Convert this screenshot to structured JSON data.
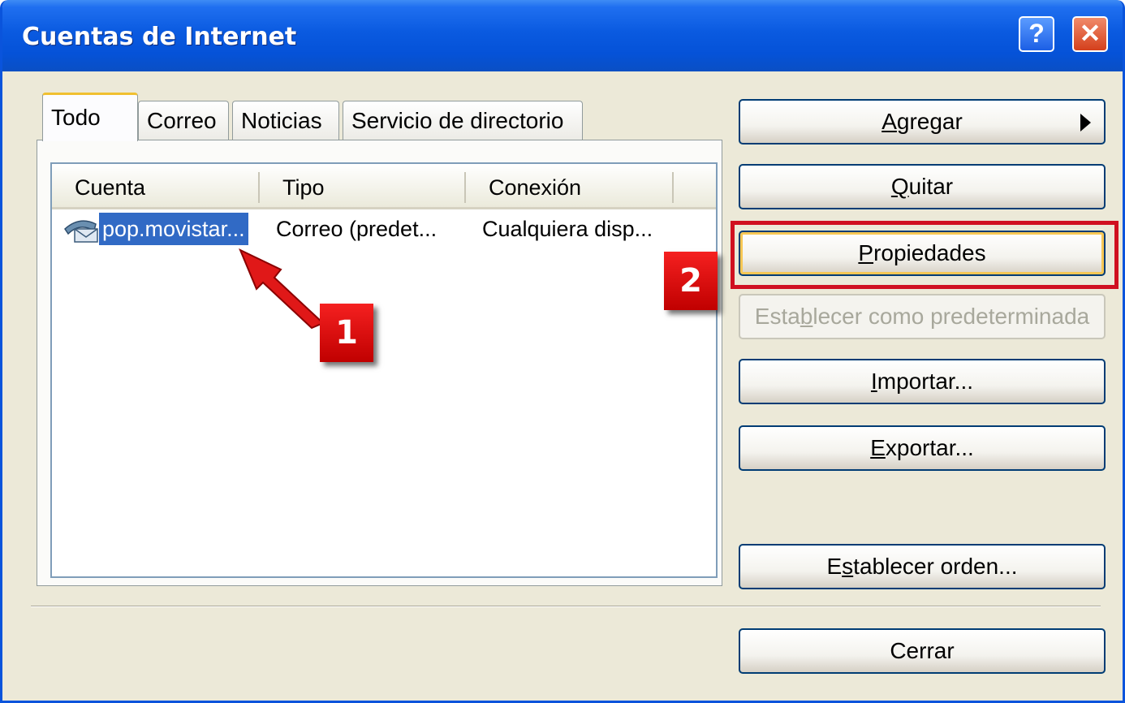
{
  "window": {
    "title": "Cuentas de Internet"
  },
  "titlebar": {
    "help_glyph": "?",
    "close_glyph": "✕"
  },
  "tabs": [
    {
      "label": "Todo",
      "active": true
    },
    {
      "label": "Correo",
      "active": false
    },
    {
      "label": "Noticias",
      "active": false
    },
    {
      "label": "Servicio de directorio",
      "active": false
    }
  ],
  "list": {
    "columns": [
      "Cuenta",
      "Tipo",
      "Conexión"
    ],
    "rows": [
      {
        "account": "pop.movistar...",
        "type": "Correo (predet...",
        "connection": "Cualquiera disp...",
        "selected": true,
        "icon": "mail-account-icon"
      }
    ]
  },
  "buttons": {
    "agregar": {
      "pre": "",
      "key": "A",
      "post": "gregar"
    },
    "quitar": {
      "pre": "",
      "key": "Q",
      "post": "uitar"
    },
    "propiedades": {
      "pre": "",
      "key": "P",
      "post": "ropiedades"
    },
    "predeterminada": {
      "pre": "Esta",
      "key": "b",
      "post": "lecer como predeterminada",
      "disabled": true
    },
    "importar": {
      "pre": "",
      "key": "I",
      "post": "mportar..."
    },
    "exportar": {
      "pre": "",
      "key": "E",
      "post": "xportar..."
    },
    "orden": {
      "pre": "E",
      "key": "s",
      "post": "tablecer orden..."
    },
    "cerrar": {
      "label": "Cerrar"
    }
  },
  "annotations": [
    {
      "label": "1",
      "color": "#d01020"
    },
    {
      "label": "2",
      "color": "#d01020"
    }
  ],
  "colors": {
    "titlebar": "#0a5ae0",
    "selection": "#316ac5",
    "highlight": "#d01020",
    "dialog_bg": "#ece9d8"
  }
}
